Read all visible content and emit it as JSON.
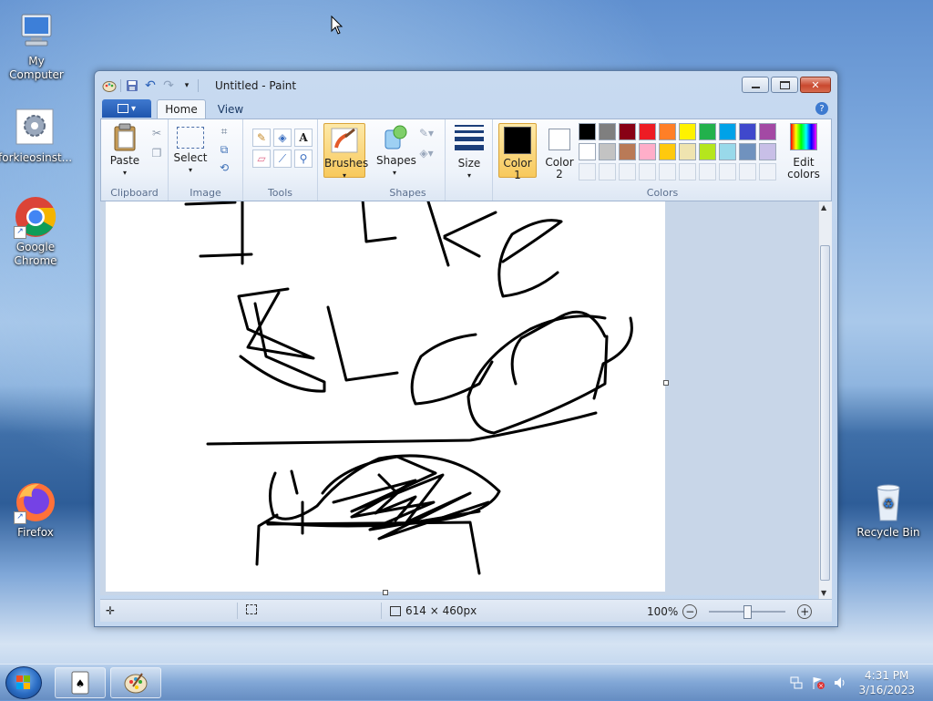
{
  "desktop": {
    "icons": [
      {
        "label": "My Computer"
      },
      {
        "label": "forkieosinst..."
      },
      {
        "label": "Google Chrome"
      },
      {
        "label": "Firefox"
      },
      {
        "label": "Recycle Bin"
      }
    ]
  },
  "window": {
    "title": "Untitled - Paint",
    "tabs": {
      "home": "Home",
      "view": "View"
    },
    "help": "?"
  },
  "ribbon": {
    "clipboard": {
      "label": "Clipboard",
      "paste": "Paste"
    },
    "image": {
      "label": "Image",
      "select": "Select"
    },
    "tools": {
      "label": "Tools"
    },
    "brushes": {
      "label": "Brushes"
    },
    "shapes": {
      "label": "Shapes",
      "button": "Shapes"
    },
    "size": {
      "label": "Size"
    },
    "colors": {
      "label": "Colors",
      "color1": "Color",
      "color1_num": "1",
      "color2": "Color",
      "color2_num": "2",
      "edit": "Edit",
      "edit2": "colors",
      "color1_value": "#000000",
      "color2_value": "#ffffff",
      "palette_row1": [
        "#000000",
        "#7f7f7f",
        "#880015",
        "#ed1c24",
        "#ff7f27",
        "#fff200",
        "#22b14c",
        "#00a2e8",
        "#3f48cc",
        "#a349a4"
      ],
      "palette_row2": [
        "#ffffff",
        "#c3c3c3",
        "#b97a57",
        "#ffaec9",
        "#ffc90e",
        "#efe4b0",
        "#b5e61d",
        "#99d9ea",
        "#7092be",
        "#c8bfe7"
      ]
    }
  },
  "status": {
    "image_size": "614 × 460px",
    "zoom": "100%"
  },
  "taskbar": {
    "time": "4:31 PM",
    "date": "3/16/2023"
  }
}
